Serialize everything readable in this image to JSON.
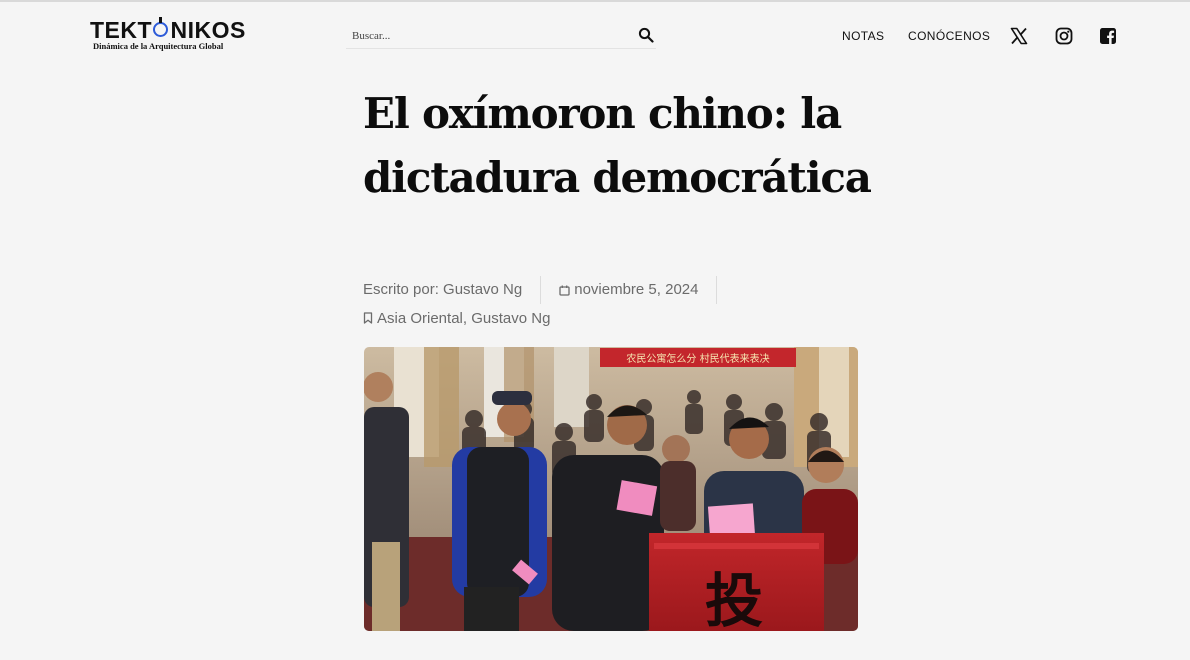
{
  "header": {
    "logo_text": "TEKTONIKOS",
    "logo_before_o": "TEKT",
    "logo_o": "O",
    "logo_after_o": "NIKOS",
    "tagline": "Dinámica de la Arquitectura Global",
    "search_placeholder": "Buscar...",
    "search_icon": "search-icon",
    "nav": [
      "NOTAS",
      "CONÓCENOS"
    ],
    "social": [
      {
        "icon": "x-icon"
      },
      {
        "icon": "instagram-icon"
      },
      {
        "icon": "facebook-icon"
      }
    ],
    "accent_color": "#2d5bd8"
  },
  "article": {
    "title": "El oxímoron chino: la dictadura democrática",
    "author": "Escrito por: Gustavo Ng",
    "date": "noviembre 5, 2024",
    "date_icon": "calendar-icon",
    "category_icon": "bookmark-icon",
    "categories": [
      "Asia Oriental",
      "Gustavo Ng"
    ],
    "category_separator": ", ",
    "banner_text": "农民公寓怎么分 村民代表来表决",
    "ballot_box_text": "投"
  }
}
